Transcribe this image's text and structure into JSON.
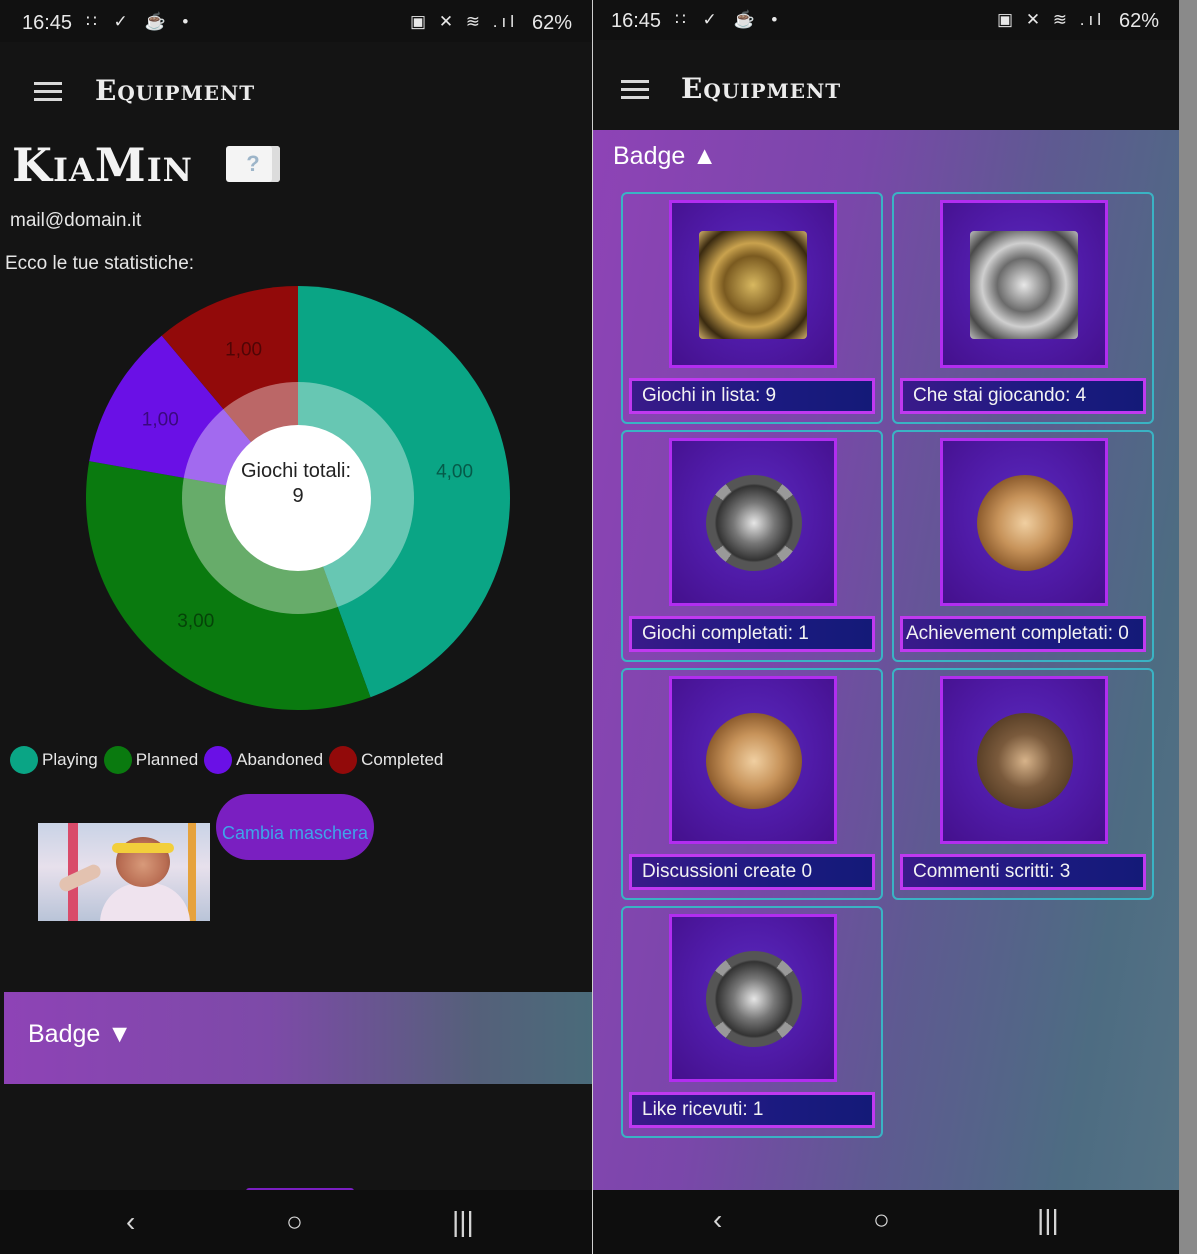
{
  "status_bar": {
    "time": "16:45",
    "battery": "62%",
    "notif_icons": "∷ ✓ ☕ •",
    "sys_icons": "▣ ✕ ≋ .ıl"
  },
  "app_bar": {
    "title": "Equipment",
    "menu_icon": "hamburger-icon"
  },
  "profile": {
    "name": "KiaMin",
    "flag_glyph": "?",
    "email": "mail@domain.it",
    "stats_intro": "Ecco le tue statistiche:"
  },
  "chart_data": {
    "type": "pie",
    "center_label_line1": "Giochi totali:",
    "center_label_line2": "9",
    "categories": [
      "Playing",
      "Planned",
      "Abandoned",
      "Completed"
    ],
    "values": [
      4,
      3,
      1,
      1
    ],
    "value_labels": [
      "4,00",
      "3,00",
      "1,00",
      "1,00"
    ],
    "colors": [
      "#0aa585",
      "#0a7a0f",
      "#6a10e6",
      "#920a0a"
    ],
    "legend_position": "bottom"
  },
  "legend": {
    "playing": "Playing",
    "planned": "Planned",
    "abandoned": "Abandoned",
    "completed": "Completed"
  },
  "mask": {
    "button_label": "Cambia maschera"
  },
  "badge_section": {
    "collapsed_label": "Badge ▼",
    "expanded_label": "Badge ▲"
  },
  "badges": [
    {
      "label": "Giochi in lista: 9",
      "icon": "gold-square-medal-icon"
    },
    {
      "label": "Che stai giocando: 4",
      "icon": "silver-square-medal-icon"
    },
    {
      "label": "Giochi completati: 1",
      "icon": "compass-medal-icon"
    },
    {
      "label": "Achievement completati: 0",
      "icon": "bronze-laurel-medal-icon"
    },
    {
      "label": "Discussioni create 0",
      "icon": "bronze-laurel-medal-icon"
    },
    {
      "label": "Commenti scritti: 3",
      "icon": "dark-bronze-medal-icon"
    },
    {
      "label": "Like ricevuti: 1",
      "icon": "compass-medal-icon"
    }
  ],
  "nav_bar": {
    "back": "‹",
    "home": "○",
    "recents": "|||"
  }
}
